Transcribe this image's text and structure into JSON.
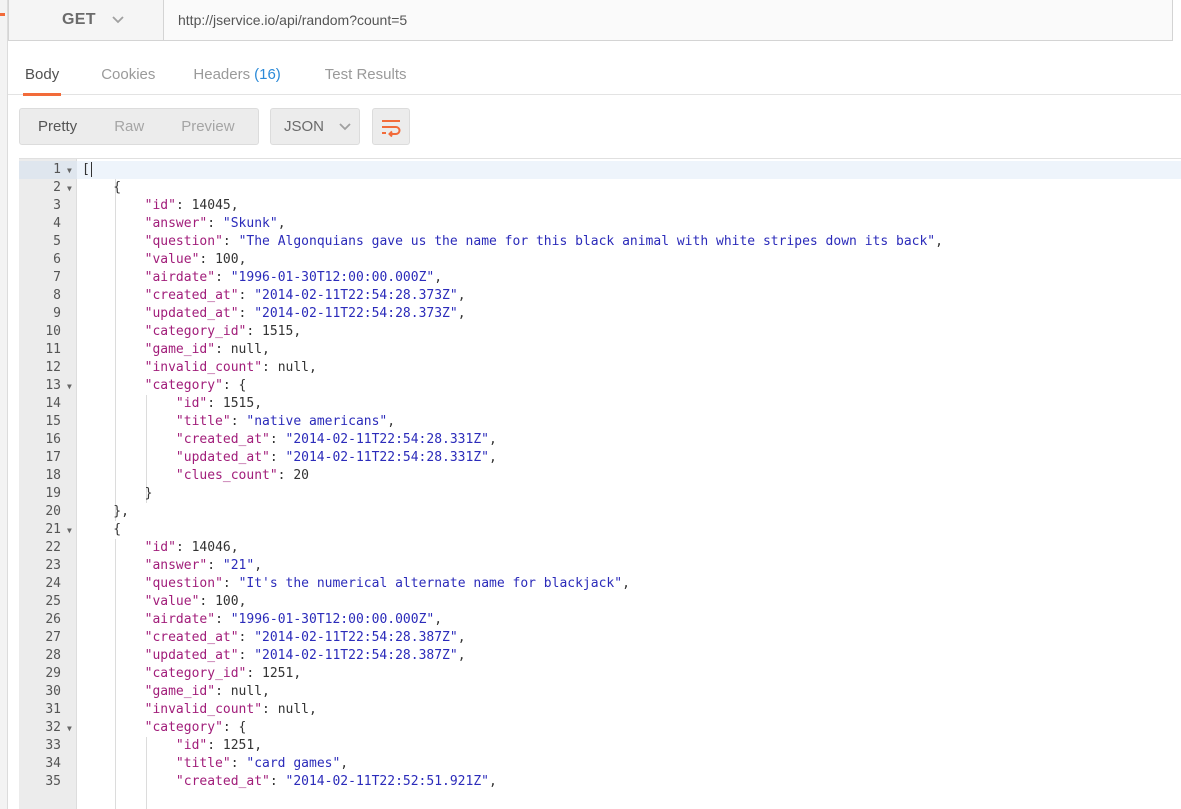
{
  "request": {
    "method": "GET",
    "url": "http://jservice.io/api/random?count=5"
  },
  "response_tabs": [
    {
      "label": "Body",
      "count": ""
    },
    {
      "label": "Cookies",
      "count": ""
    },
    {
      "label": "Headers",
      "count": "(16)"
    },
    {
      "label": "Test Results",
      "count": ""
    }
  ],
  "view_modes": [
    "Pretty",
    "Raw",
    "Preview"
  ],
  "format": "JSON",
  "icons": {
    "method_dropdown": "chevron-down-icon",
    "format_dropdown": "chevron-down-icon",
    "wrap": "wrap-lines-icon",
    "fold": "fold-arrow-icon"
  },
  "colors": {
    "accent": "#f26b3a",
    "key": "#a11d7a",
    "string": "#2b2bba",
    "link_count": "#2b8ad8"
  },
  "code_lines": [
    {
      "n": 1,
      "fold": true,
      "t": [
        [
          "p",
          "["
        ]
      ]
    },
    {
      "n": 2,
      "fold": true,
      "t": [
        [
          "p",
          "    {"
        ]
      ]
    },
    {
      "n": 3,
      "t": [
        [
          "p",
          "        "
        ],
        [
          "k",
          "\"id\""
        ],
        [
          "p",
          ": "
        ],
        [
          "n",
          "14045"
        ],
        [
          "p",
          ","
        ]
      ]
    },
    {
      "n": 4,
      "t": [
        [
          "p",
          "        "
        ],
        [
          "k",
          "\"answer\""
        ],
        [
          "p",
          ": "
        ],
        [
          "s",
          "\"Skunk\""
        ],
        [
          "p",
          ","
        ]
      ]
    },
    {
      "n": 5,
      "t": [
        [
          "p",
          "        "
        ],
        [
          "k",
          "\"question\""
        ],
        [
          "p",
          ": "
        ],
        [
          "s",
          "\"The Algonquians gave us the name for this black animal with white stripes down its back\""
        ],
        [
          "p",
          ","
        ]
      ]
    },
    {
      "n": 6,
      "t": [
        [
          "p",
          "        "
        ],
        [
          "k",
          "\"value\""
        ],
        [
          "p",
          ": "
        ],
        [
          "n",
          "100"
        ],
        [
          "p",
          ","
        ]
      ]
    },
    {
      "n": 7,
      "t": [
        [
          "p",
          "        "
        ],
        [
          "k",
          "\"airdate\""
        ],
        [
          "p",
          ": "
        ],
        [
          "s",
          "\"1996-01-30T12:00:00.000Z\""
        ],
        [
          "p",
          ","
        ]
      ]
    },
    {
      "n": 8,
      "t": [
        [
          "p",
          "        "
        ],
        [
          "k",
          "\"created_at\""
        ],
        [
          "p",
          ": "
        ],
        [
          "s",
          "\"2014-02-11T22:54:28.373Z\""
        ],
        [
          "p",
          ","
        ]
      ]
    },
    {
      "n": 9,
      "t": [
        [
          "p",
          "        "
        ],
        [
          "k",
          "\"updated_at\""
        ],
        [
          "p",
          ": "
        ],
        [
          "s",
          "\"2014-02-11T22:54:28.373Z\""
        ],
        [
          "p",
          ","
        ]
      ]
    },
    {
      "n": 10,
      "t": [
        [
          "p",
          "        "
        ],
        [
          "k",
          "\"category_id\""
        ],
        [
          "p",
          ": "
        ],
        [
          "n",
          "1515"
        ],
        [
          "p",
          ","
        ]
      ]
    },
    {
      "n": 11,
      "t": [
        [
          "p",
          "        "
        ],
        [
          "k",
          "\"game_id\""
        ],
        [
          "p",
          ": "
        ],
        [
          "n",
          "null"
        ],
        [
          "p",
          ","
        ]
      ]
    },
    {
      "n": 12,
      "t": [
        [
          "p",
          "        "
        ],
        [
          "k",
          "\"invalid_count\""
        ],
        [
          "p",
          ": "
        ],
        [
          "n",
          "null"
        ],
        [
          "p",
          ","
        ]
      ]
    },
    {
      "n": 13,
      "fold": true,
      "t": [
        [
          "p",
          "        "
        ],
        [
          "k",
          "\"category\""
        ],
        [
          "p",
          ": {"
        ]
      ]
    },
    {
      "n": 14,
      "t": [
        [
          "p",
          "            "
        ],
        [
          "k",
          "\"id\""
        ],
        [
          "p",
          ": "
        ],
        [
          "n",
          "1515"
        ],
        [
          "p",
          ","
        ]
      ]
    },
    {
      "n": 15,
      "t": [
        [
          "p",
          "            "
        ],
        [
          "k",
          "\"title\""
        ],
        [
          "p",
          ": "
        ],
        [
          "s",
          "\"native americans\""
        ],
        [
          "p",
          ","
        ]
      ]
    },
    {
      "n": 16,
      "t": [
        [
          "p",
          "            "
        ],
        [
          "k",
          "\"created_at\""
        ],
        [
          "p",
          ": "
        ],
        [
          "s",
          "\"2014-02-11T22:54:28.331Z\""
        ],
        [
          "p",
          ","
        ]
      ]
    },
    {
      "n": 17,
      "t": [
        [
          "p",
          "            "
        ],
        [
          "k",
          "\"updated_at\""
        ],
        [
          "p",
          ": "
        ],
        [
          "s",
          "\"2014-02-11T22:54:28.331Z\""
        ],
        [
          "p",
          ","
        ]
      ]
    },
    {
      "n": 18,
      "t": [
        [
          "p",
          "            "
        ],
        [
          "k",
          "\"clues_count\""
        ],
        [
          "p",
          ": "
        ],
        [
          "n",
          "20"
        ]
      ]
    },
    {
      "n": 19,
      "t": [
        [
          "p",
          "        }"
        ]
      ]
    },
    {
      "n": 20,
      "t": [
        [
          "p",
          "    },"
        ]
      ]
    },
    {
      "n": 21,
      "fold": true,
      "t": [
        [
          "p",
          "    {"
        ]
      ]
    },
    {
      "n": 22,
      "t": [
        [
          "p",
          "        "
        ],
        [
          "k",
          "\"id\""
        ],
        [
          "p",
          ": "
        ],
        [
          "n",
          "14046"
        ],
        [
          "p",
          ","
        ]
      ]
    },
    {
      "n": 23,
      "t": [
        [
          "p",
          "        "
        ],
        [
          "k",
          "\"answer\""
        ],
        [
          "p",
          ": "
        ],
        [
          "s",
          "\"21\""
        ],
        [
          "p",
          ","
        ]
      ]
    },
    {
      "n": 24,
      "t": [
        [
          "p",
          "        "
        ],
        [
          "k",
          "\"question\""
        ],
        [
          "p",
          ": "
        ],
        [
          "s",
          "\"It's the numerical alternate name for blackjack\""
        ],
        [
          "p",
          ","
        ]
      ]
    },
    {
      "n": 25,
      "t": [
        [
          "p",
          "        "
        ],
        [
          "k",
          "\"value\""
        ],
        [
          "p",
          ": "
        ],
        [
          "n",
          "100"
        ],
        [
          "p",
          ","
        ]
      ]
    },
    {
      "n": 26,
      "t": [
        [
          "p",
          "        "
        ],
        [
          "k",
          "\"airdate\""
        ],
        [
          "p",
          ": "
        ],
        [
          "s",
          "\"1996-01-30T12:00:00.000Z\""
        ],
        [
          "p",
          ","
        ]
      ]
    },
    {
      "n": 27,
      "t": [
        [
          "p",
          "        "
        ],
        [
          "k",
          "\"created_at\""
        ],
        [
          "p",
          ": "
        ],
        [
          "s",
          "\"2014-02-11T22:54:28.387Z\""
        ],
        [
          "p",
          ","
        ]
      ]
    },
    {
      "n": 28,
      "t": [
        [
          "p",
          "        "
        ],
        [
          "k",
          "\"updated_at\""
        ],
        [
          "p",
          ": "
        ],
        [
          "s",
          "\"2014-02-11T22:54:28.387Z\""
        ],
        [
          "p",
          ","
        ]
      ]
    },
    {
      "n": 29,
      "t": [
        [
          "p",
          "        "
        ],
        [
          "k",
          "\"category_id\""
        ],
        [
          "p",
          ": "
        ],
        [
          "n",
          "1251"
        ],
        [
          "p",
          ","
        ]
      ]
    },
    {
      "n": 30,
      "t": [
        [
          "p",
          "        "
        ],
        [
          "k",
          "\"game_id\""
        ],
        [
          "p",
          ": "
        ],
        [
          "n",
          "null"
        ],
        [
          "p",
          ","
        ]
      ]
    },
    {
      "n": 31,
      "t": [
        [
          "p",
          "        "
        ],
        [
          "k",
          "\"invalid_count\""
        ],
        [
          "p",
          ": "
        ],
        [
          "n",
          "null"
        ],
        [
          "p",
          ","
        ]
      ]
    },
    {
      "n": 32,
      "fold": true,
      "t": [
        [
          "p",
          "        "
        ],
        [
          "k",
          "\"category\""
        ],
        [
          "p",
          ": {"
        ]
      ]
    },
    {
      "n": 33,
      "t": [
        [
          "p",
          "            "
        ],
        [
          "k",
          "\"id\""
        ],
        [
          "p",
          ": "
        ],
        [
          "n",
          "1251"
        ],
        [
          "p",
          ","
        ]
      ]
    },
    {
      "n": 34,
      "t": [
        [
          "p",
          "            "
        ],
        [
          "k",
          "\"title\""
        ],
        [
          "p",
          ": "
        ],
        [
          "s",
          "\"card games\""
        ],
        [
          "p",
          ","
        ]
      ]
    },
    {
      "n": 35,
      "t": [
        [
          "p",
          "            "
        ],
        [
          "k",
          "\"created_at\""
        ],
        [
          "p",
          ": "
        ],
        [
          "s",
          "\"2014-02-11T22:52:51.921Z\""
        ],
        [
          "p",
          ","
        ]
      ]
    }
  ]
}
